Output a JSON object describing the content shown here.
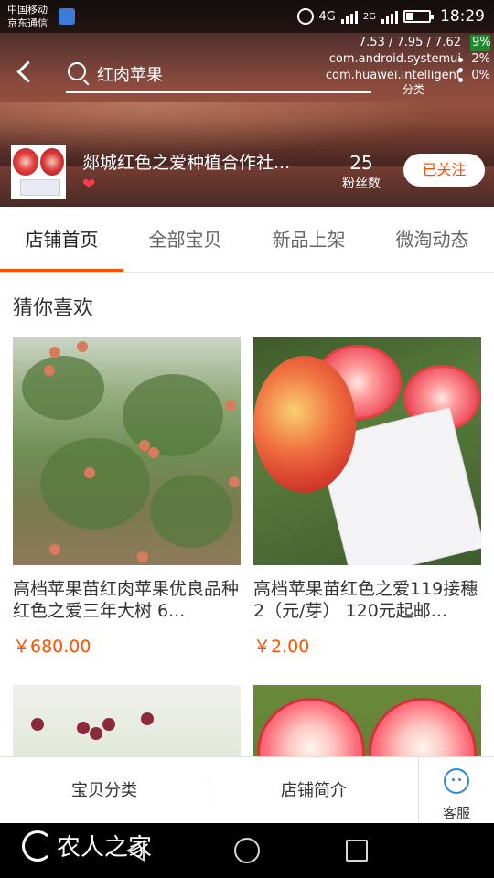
{
  "status_bar": {
    "carrier_1": "中国移动",
    "carrier_2": "京东通信",
    "network_1": "4G",
    "network_2": "4G",
    "network_3": "2G",
    "time": "18:29"
  },
  "debug_overlay": {
    "load": "7.53 / 7.95 / 7.62",
    "proc_1": "com.android.systemui",
    "proc_2": "com.huawei.intelligent",
    "pct_0": "9%",
    "pct_1": "2%",
    "pct_2": "0%"
  },
  "header": {
    "search_text": "红肉苹果",
    "category_label": "分类"
  },
  "shop": {
    "name": "郯城红色之爱种植合作社...",
    "heart": "❤",
    "fans_count": "25",
    "fans_label": "粉丝数",
    "follow_label": "已关注"
  },
  "tabs": [
    {
      "label": "店铺首页",
      "active": true
    },
    {
      "label": "全部宝贝",
      "active": false
    },
    {
      "label": "新品上架",
      "active": false
    },
    {
      "label": "微淘动态",
      "active": false
    }
  ],
  "section": {
    "title": "猜你喜欢"
  },
  "products": [
    {
      "title": "高档苹果苗红肉苹果优良品种红色之爱三年大树 6...",
      "price": "￥680.00"
    },
    {
      "title": "高档苹果苗红色之爱119接穗 2（元/芽） 120元起邮...",
      "price": "￥2.00"
    },
    {
      "title": "",
      "price": ""
    },
    {
      "title": "",
      "price": ""
    }
  ],
  "bottom_bar": {
    "category_label": "宝贝分类",
    "intro_label": "店铺简介",
    "service_label": "客服"
  },
  "watermark": {
    "text": "农人之家"
  },
  "colors": {
    "accent": "#ff5000",
    "service_blue": "#2a8ad8"
  }
}
